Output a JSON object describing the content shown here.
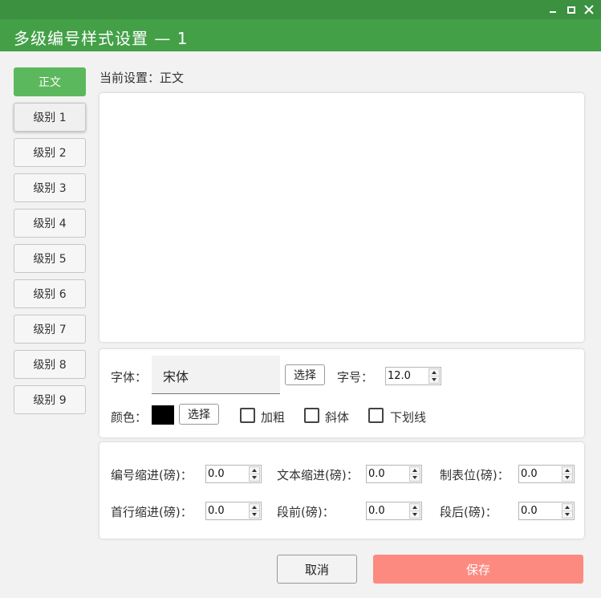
{
  "window": {
    "title": "多级编号样式设置 — 1",
    "controls": [
      "minimize-icon",
      "maximize-icon",
      "close-icon"
    ]
  },
  "sidebar": {
    "items": [
      {
        "label": "正文",
        "active": true
      },
      {
        "label": "级别 1"
      },
      {
        "label": "级别 2"
      },
      {
        "label": "级别 3"
      },
      {
        "label": "级别 4"
      },
      {
        "label": "级别 5"
      },
      {
        "label": "级别 6"
      },
      {
        "label": "级别 7"
      },
      {
        "label": "级别 8"
      },
      {
        "label": "级别 9"
      }
    ]
  },
  "current": {
    "label": "当前设置：正文"
  },
  "font": {
    "label": "字体：",
    "value": "宋体",
    "pick_label": "选择",
    "size_label": "字号：",
    "size_value": "12.0"
  },
  "color": {
    "label": "颜色：",
    "swatch": "#000000",
    "pick_label": "选择"
  },
  "styles": {
    "bold": "加粗",
    "italic": "斜体",
    "underline": "下划线"
  },
  "indent": {
    "number_indent_label": "编号缩进(磅)：",
    "number_indent_value": "0.0",
    "text_indent_label": "文本缩进(磅)：",
    "text_indent_value": "0.0",
    "tab_label": "制表位(磅)：",
    "tab_value": "0.0",
    "first_line_label": "首行缩进(磅)：",
    "first_line_value": "0.0",
    "before_label": "段前(磅)：",
    "before_value": "0.0",
    "after_label": "段后(磅)：",
    "after_value": "0.0"
  },
  "footer": {
    "cancel": "取消",
    "save": "保存"
  },
  "colors": {
    "accent": "#43a047",
    "save": "#fd8a80"
  }
}
